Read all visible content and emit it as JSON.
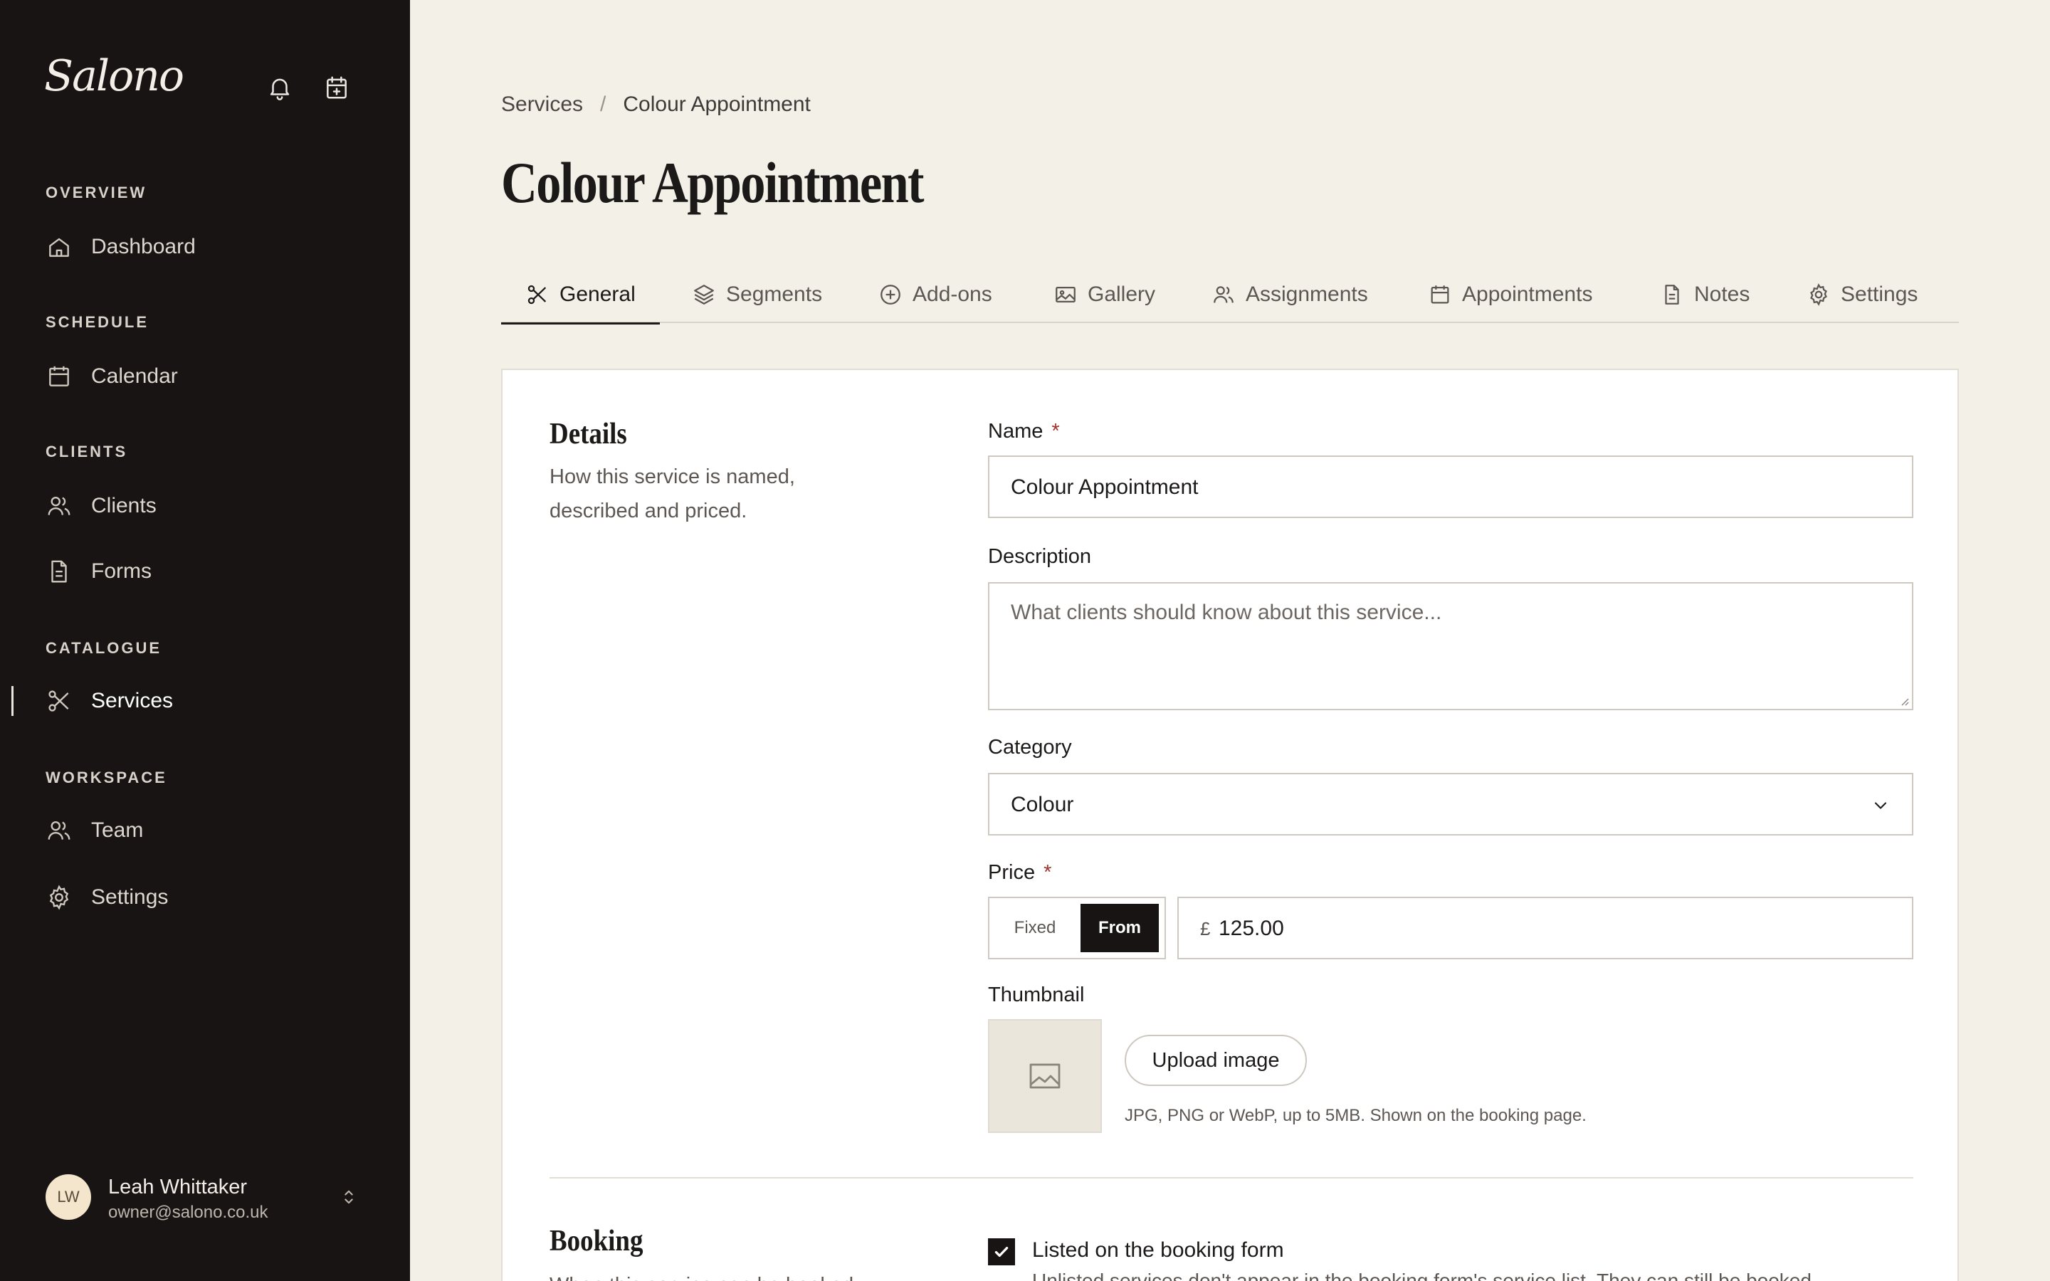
{
  "app": {
    "brand": "Salono"
  },
  "sidebar": {
    "top_icons": [
      "bell-icon",
      "calendar-plus-icon"
    ],
    "sections": [
      {
        "label": "OVERVIEW",
        "items": [
          {
            "label": "Dashboard",
            "icon": "home-icon"
          }
        ]
      },
      {
        "label": "SCHEDULE",
        "items": [
          {
            "label": "Calendar",
            "icon": "calendar-icon"
          }
        ]
      },
      {
        "label": "CLIENTS",
        "items": [
          {
            "label": "Clients",
            "icon": "users-icon"
          },
          {
            "label": "Forms",
            "icon": "document-icon"
          }
        ]
      },
      {
        "label": "CATALOGUE",
        "items": [
          {
            "label": "Services",
            "icon": "scissors-icon",
            "active": true
          }
        ]
      },
      {
        "label": "WORKSPACE",
        "items": [
          {
            "label": "Team",
            "icon": "users-icon"
          },
          {
            "label": "Settings",
            "icon": "gear-icon"
          }
        ]
      }
    ],
    "user": {
      "initials": "LW",
      "name": "Leah Whittaker",
      "email": "owner@salono.co.uk"
    }
  },
  "breadcrumb": {
    "parent": "Services",
    "separator": "/",
    "current": "Colour Appointment"
  },
  "page_title": "Colour Appointment",
  "tabs": [
    {
      "label": "General",
      "icon": "scissors-icon",
      "active": true
    },
    {
      "label": "Segments",
      "icon": "layers-icon"
    },
    {
      "label": "Add-ons",
      "icon": "plus-circle-icon"
    },
    {
      "label": "Gallery",
      "icon": "image-icon"
    },
    {
      "label": "Assignments",
      "icon": "users-icon"
    },
    {
      "label": "Appointments",
      "icon": "calendar-icon"
    },
    {
      "label": "Notes",
      "icon": "document-icon"
    },
    {
      "label": "Settings",
      "icon": "gear-icon"
    }
  ],
  "details": {
    "title": "Details",
    "description": "How this service is named, described and priced.",
    "name_label": "Name",
    "required_mark": "*",
    "name_value": "Colour Appointment",
    "description_label": "Description",
    "description_placeholder": "What clients should know about this service...",
    "category_label": "Category",
    "category_value": "Colour",
    "price_label": "Price",
    "price_modes": [
      "Fixed",
      "From"
    ],
    "price_mode_selected": "From",
    "currency_symbol": "£",
    "price_value": "125.00",
    "thumbnail_label": "Thumbnail",
    "upload_label": "Upload image",
    "upload_hint": "JPG, PNG or WebP, up to 5MB. Shown on the booking page."
  },
  "booking": {
    "title": "Booking",
    "description": "When this service can be booked",
    "listed_checked": true,
    "listed_label": "Listed on the booking form",
    "listed_help": "Unlisted services don't appear in the booking form's service list. They can still be booked"
  }
}
